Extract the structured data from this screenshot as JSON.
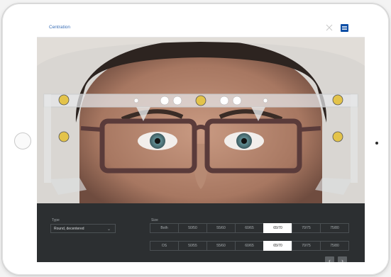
{
  "app": {
    "title": "Centration"
  },
  "panel": {
    "type_label": "Type",
    "type_value": "Round, decentered",
    "size_label": "Size",
    "rows": [
      {
        "label": "Both",
        "options": [
          "50/50",
          "55/60",
          "60/65",
          "65/70",
          "70/75",
          "75/80"
        ],
        "selected": "65/70"
      },
      {
        "label": "OS",
        "options": [
          "50/55",
          "55/60",
          "60/65",
          "65/70",
          "70/75",
          "75/80"
        ],
        "selected": "65/70"
      }
    ]
  },
  "nav": {
    "prev": "‹",
    "next": "›"
  },
  "icons": {
    "close": "close-icon",
    "logo": "brand-logo",
    "dropdown": "chevron-down-icon"
  },
  "colors": {
    "accent": "#3a6fb7",
    "panel": "#2c2f31",
    "logo": "#0e4fa6"
  }
}
